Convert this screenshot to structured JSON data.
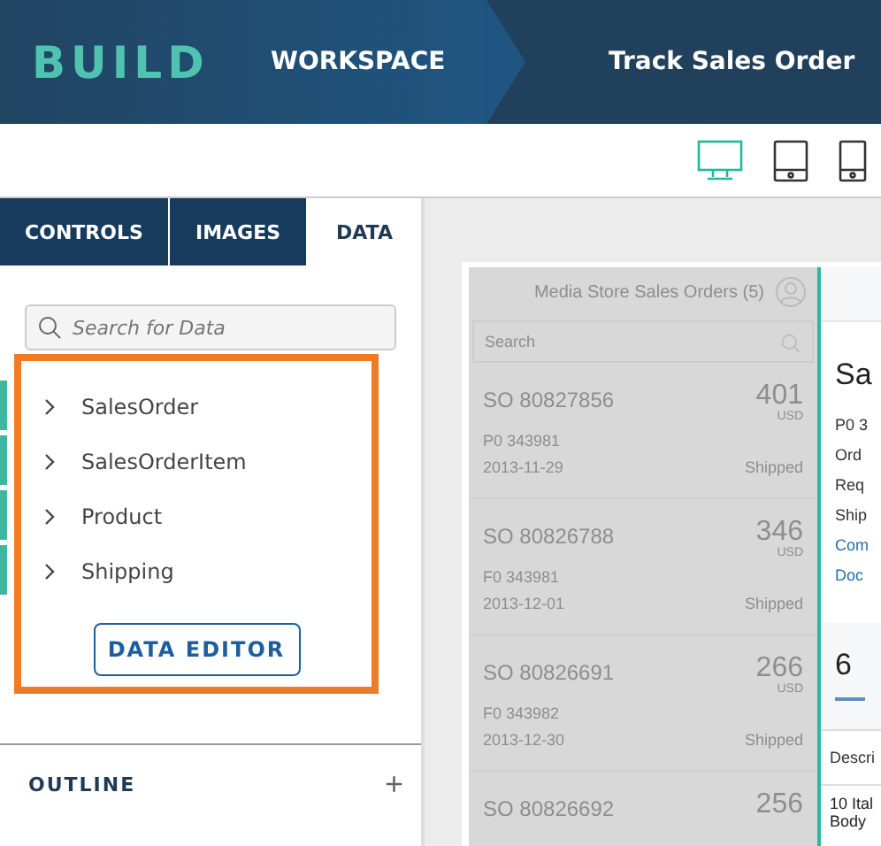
{
  "header": {
    "logo": "BUILD",
    "workspace": "WORKSPACE",
    "project": "Track Sales Order"
  },
  "devices": [
    {
      "kind": "desktop",
      "selected": true
    },
    {
      "kind": "tablet",
      "selected": false
    },
    {
      "kind": "phone",
      "selected": false
    }
  ],
  "tabs": [
    {
      "label": "CONTROLS",
      "selected": false
    },
    {
      "label": "IMAGES",
      "selected": false
    },
    {
      "label": "DATA",
      "selected": true
    }
  ],
  "search": {
    "placeholder": "Search for Data"
  },
  "entities": [
    {
      "name": "SalesOrder",
      "expanded": false
    },
    {
      "name": "SalesOrderItem",
      "expanded": false
    },
    {
      "name": "Product",
      "expanded": false
    },
    {
      "name": "Shipping",
      "expanded": false
    }
  ],
  "data_editor_button": "DATA EDITOR",
  "outline": {
    "title": "OUTLINE",
    "add": "+"
  },
  "preview": {
    "list_title": "Media Store Sales Orders (5)",
    "search_placeholder": "Search",
    "orders": [
      {
        "id": "SO 80827856",
        "amount": "401",
        "currency": "USD",
        "po": "P0 343981",
        "date": "2013-11-29",
        "status": "Shipped"
      },
      {
        "id": "SO 80826788",
        "amount": "346",
        "currency": "USD",
        "po": "F0 343981",
        "date": "2013-12-01",
        "status": "Shipped"
      },
      {
        "id": "SO 80826691",
        "amount": "266",
        "currency": "USD",
        "po": "F0 343982",
        "date": "2013-12-30",
        "status": "Shipped"
      },
      {
        "id": "SO 80826692",
        "amount": "256"
      }
    ],
    "detail": {
      "title": "Sa",
      "fields": [
        {
          "text": "P0 3",
          "kind": "text"
        },
        {
          "text": "Ord",
          "kind": "text"
        },
        {
          "text": "Req",
          "kind": "text"
        },
        {
          "text": "Ship",
          "kind": "text"
        },
        {
          "text": "Com",
          "kind": "link"
        },
        {
          "text": "Doc",
          "kind": "link"
        }
      ],
      "count": "6",
      "column": "Descri",
      "item_lines": [
        "10 Ital",
        "Body"
      ]
    }
  }
}
